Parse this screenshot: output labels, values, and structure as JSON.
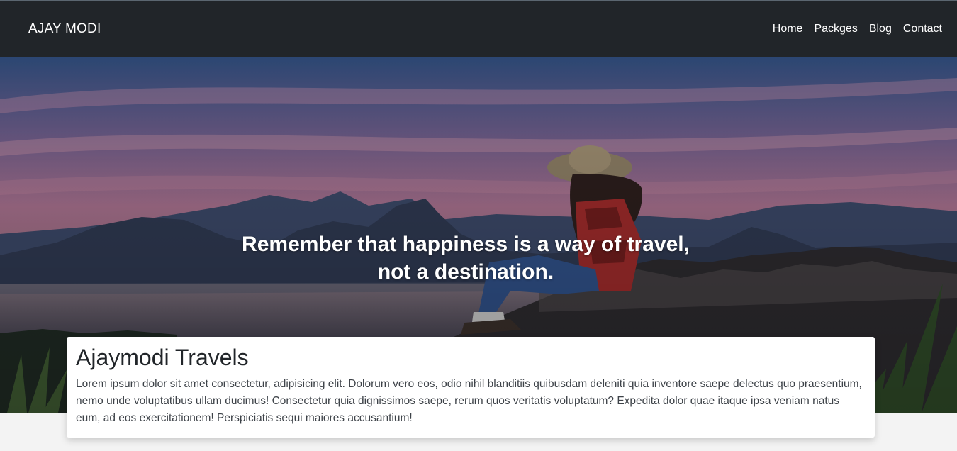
{
  "navbar": {
    "brand": "AJAY MODI",
    "links": [
      "Home",
      "Packges",
      "Blog",
      "Contact"
    ]
  },
  "hero": {
    "quote_line1": "Remember that happiness is a way of travel,",
    "quote_line2": "not a destination."
  },
  "card": {
    "title": "Ajaymodi Travels",
    "text": "Lorem ipsum dolor sit amet consectetur, adipisicing elit. Dolorum vero eos, odio nihil blanditiis quibusdam deleniti quia inventore saepe delectus quo praesentium, nemo unde voluptatibus ullam ducimus! Consectetur quia dignissimos saepe, rerum quos veritatis voluptatum? Expedita dolor quae itaque ipsa veniam natus eum, ad eos exercitationem! Perspiciatis sequi maiores accusantium!"
  },
  "colors": {
    "navbar_bg": "#212529",
    "page_bg": "#f3f3f3"
  }
}
